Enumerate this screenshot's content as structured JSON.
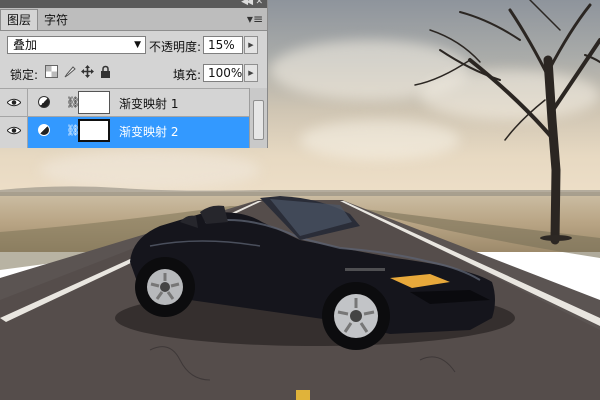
{
  "panel": {
    "tabs": [
      {
        "label": "图层",
        "active": true
      },
      {
        "label": "字符",
        "active": false
      }
    ],
    "menu_icon": "panel-menu-icon",
    "blend_mode": "叠加",
    "opacity_label": "不透明度:",
    "opacity_value": "15%",
    "lock_label": "锁定:",
    "lock_icons": [
      "lock-transparent-icon",
      "lock-paint-icon",
      "lock-move-icon",
      "lock-all-icon"
    ],
    "fill_label": "填充:",
    "fill_value": "100%",
    "layers": [
      {
        "name": "渐变映射 1",
        "selected": false,
        "visible": true
      },
      {
        "name": "渐变映射 2",
        "selected": true,
        "visible": true
      }
    ]
  },
  "colors": {
    "selected_layer": "#3399ff",
    "panel_bg": "#d4d4d4"
  }
}
